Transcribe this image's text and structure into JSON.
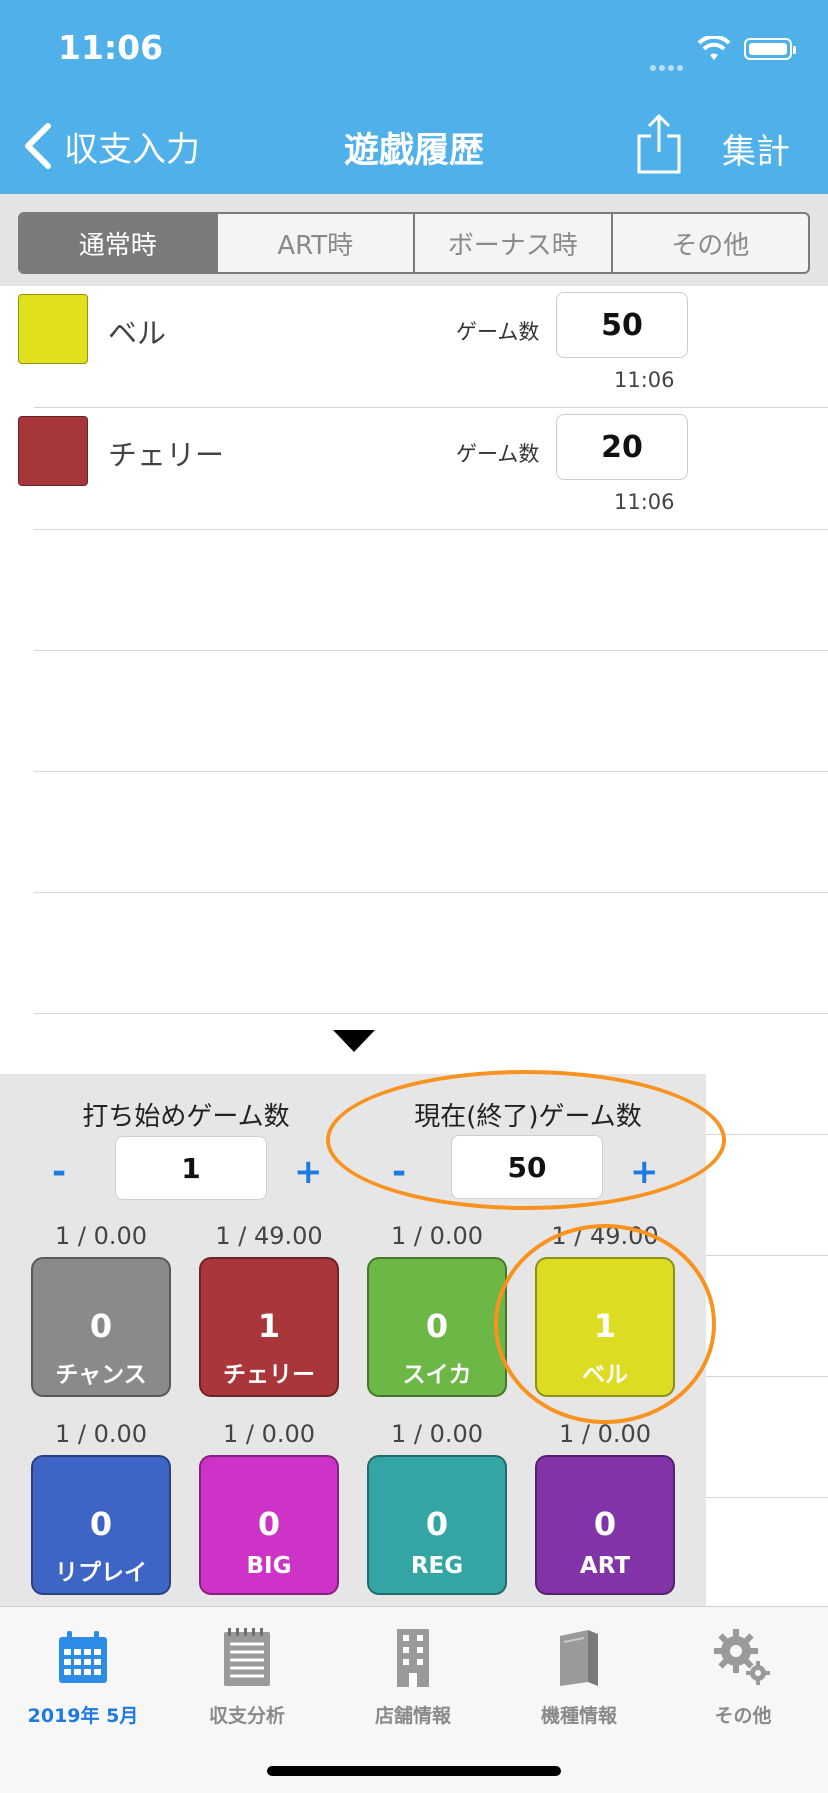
{
  "status": {
    "time": "11:06"
  },
  "nav": {
    "back_label": "収支入力",
    "title": "遊戯履歴",
    "right_label": "集計"
  },
  "segments": [
    {
      "label": "通常時",
      "active": true
    },
    {
      "label": "ART時",
      "active": false
    },
    {
      "label": "ボーナス時",
      "active": false
    },
    {
      "label": "その他",
      "active": false
    }
  ],
  "records": [
    {
      "name": "ベル",
      "color": "#e1e01f",
      "game_label": "ゲーム数",
      "games": "50",
      "time": "11:06"
    },
    {
      "name": "チェリー",
      "color": "#a6363a",
      "game_label": "ゲーム数",
      "games": "20",
      "time": "11:06"
    }
  ],
  "panel": {
    "start": {
      "label": "打ち始めゲーム数",
      "minus": "-",
      "value": "1",
      "plus": "+"
    },
    "current": {
      "label": "現在(終了)ゲーム数",
      "minus": "-",
      "value": "50",
      "plus": "+"
    },
    "counters": [
      {
        "ratio": "1 / 0.00",
        "count": "0",
        "label": "チャンス",
        "color": "#8a8a8a"
      },
      {
        "ratio": "1 / 49.00",
        "count": "1",
        "label": "チェリー",
        "color": "#a9363b"
      },
      {
        "ratio": "1 / 0.00",
        "count": "0",
        "label": "スイカ",
        "color": "#6cb746"
      },
      {
        "ratio": "1 / 49.00",
        "count": "1",
        "label": "ベル",
        "color": "#dcdc22"
      },
      {
        "ratio": "1 / 0.00",
        "count": "0",
        "label": "リプレイ",
        "color": "#3e64c6"
      },
      {
        "ratio": "1 / 0.00",
        "count": "0",
        "label": "BIG",
        "color": "#cc33c6"
      },
      {
        "ratio": "1 / 0.00",
        "count": "0",
        "label": "REG",
        "color": "#33a5a4"
      },
      {
        "ratio": "1 / 0.00",
        "count": "0",
        "label": "ART",
        "color": "#8233a8"
      }
    ]
  },
  "tabs": [
    {
      "label": "2019年 5月",
      "icon": "calendar-icon",
      "active": true
    },
    {
      "label": "収支分析",
      "icon": "notepad-icon",
      "active": false
    },
    {
      "label": "店舗情報",
      "icon": "building-icon",
      "active": false
    },
    {
      "label": "機種情報",
      "icon": "book-icon",
      "active": false
    },
    {
      "label": "その他",
      "icon": "gear-icon",
      "active": false
    }
  ],
  "colors": {
    "nav_bg": "#4fb0ea",
    "accent": "#1f7ae0",
    "highlight_ring": "#f7931e"
  }
}
